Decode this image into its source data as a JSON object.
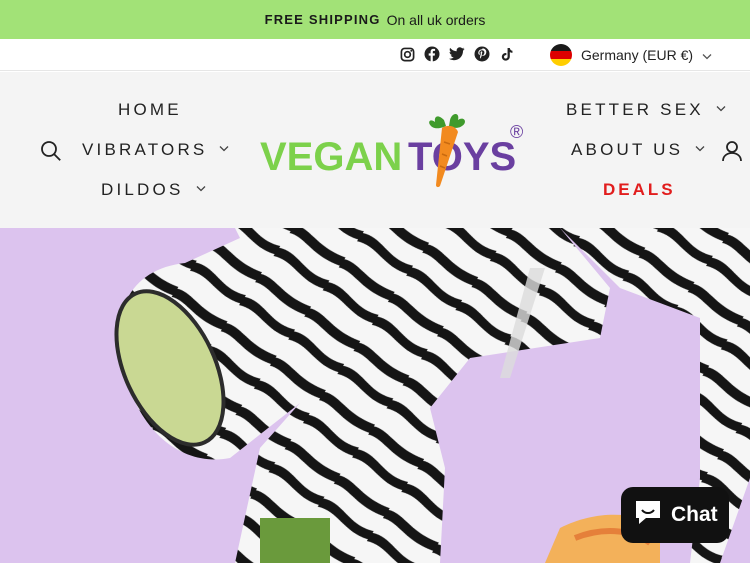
{
  "announcement": {
    "bold": "FREE SHIPPING",
    "text": "On all uk orders"
  },
  "social_icons": [
    "instagram-icon",
    "facebook-icon",
    "twitter-icon",
    "pinterest-icon",
    "tiktok-icon"
  ],
  "currency": {
    "label": "Germany (EUR €)",
    "flag": "germany-flag-icon"
  },
  "nav": {
    "home": "HOME",
    "vibrators": "VIBRATORS",
    "dildos": "DILDOS",
    "better_sex": "BETTER SEX",
    "about_us": "ABOUT US",
    "deals": "DEALS"
  },
  "logo": {
    "part1": "VEGAN",
    "part2": "TOYS",
    "registered": "®"
  },
  "chat": {
    "label": "Chat"
  },
  "colors": {
    "announcement_bg": "#a2e277",
    "logo_green": "#7cd14b",
    "logo_purple": "#6a3fa0",
    "deals_red": "#e11d1d",
    "hero_bg": "#dcc3ee"
  }
}
